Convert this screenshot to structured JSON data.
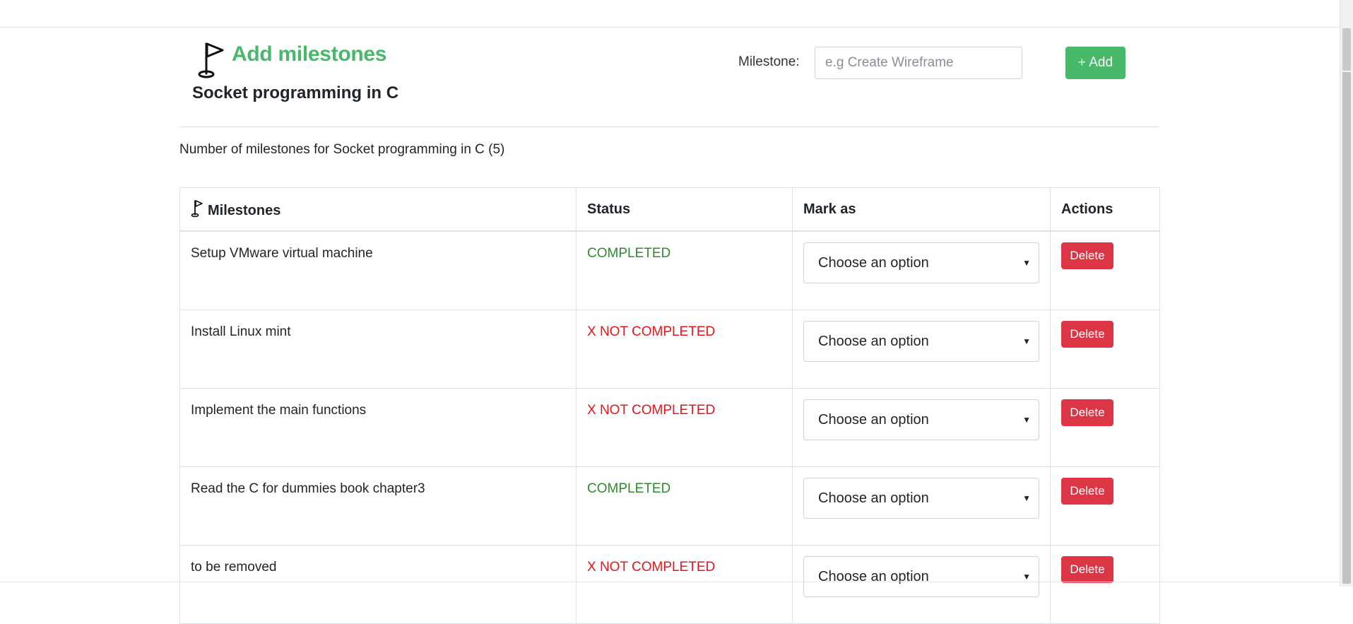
{
  "header": {
    "title": "Add milestones",
    "project_name": "Socket programming in C",
    "flag_icon": "golf-flag-icon"
  },
  "form": {
    "label": "Milestone:",
    "placeholder": "e.g Create Wireframe",
    "value": "",
    "add_label": "+ Add"
  },
  "summary": {
    "text": "Number of milestones for Socket programming in C (5)"
  },
  "table": {
    "headers": {
      "milestones": "Milestones",
      "status": "Status",
      "mark_as": "Mark as",
      "actions": "Actions"
    },
    "rows": [
      {
        "name": "Setup VMware virtual machine",
        "status": "COMPLETED",
        "mark_as": "Choose an option",
        "action": "Delete"
      },
      {
        "name": "Install Linux mint",
        "status": "X NOT COMPLETED",
        "mark_as": "Choose an option",
        "action": "Delete"
      },
      {
        "name": "Implement the main functions",
        "status": "X NOT COMPLETED",
        "mark_as": "Choose an option",
        "action": "Delete"
      },
      {
        "name": "Read the C for dummies book chapter3",
        "status": "COMPLETED",
        "mark_as": "Choose an option",
        "action": "Delete"
      },
      {
        "name": "to be removed",
        "status": "X NOT COMPLETED",
        "mark_as": "Choose an option",
        "action": "Delete"
      }
    ]
  },
  "colors": {
    "accent": "#48b96a",
    "completed": "#2e8b2e",
    "not_completed": "#e8141c",
    "delete": "#dc3545"
  }
}
